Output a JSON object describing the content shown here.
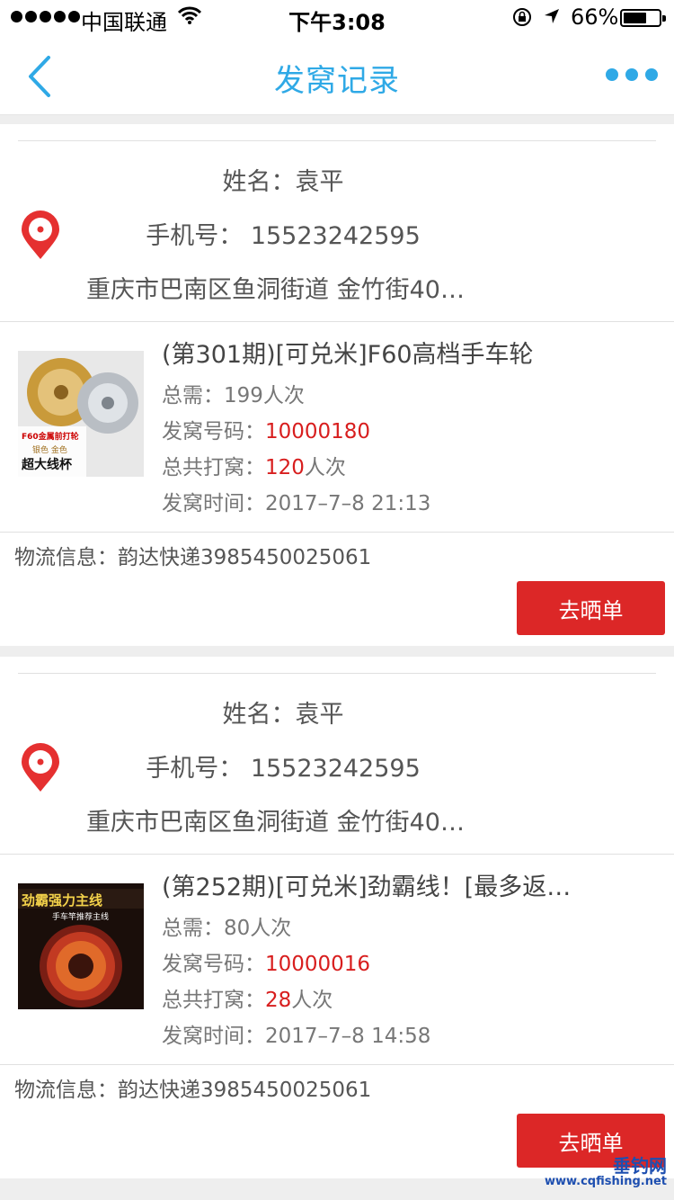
{
  "status_bar": {
    "carrier": "中国联通",
    "time": "下午3:08",
    "battery_percent": "66%",
    "battery_level": 0.66
  },
  "nav": {
    "title": "发窝记录"
  },
  "records": [
    {
      "name_label": "姓名：",
      "name": "袁平",
      "phone_label": "手机号：",
      "phone": "15523242595",
      "address": "重庆市巴南区鱼洞街道 金竹街40…",
      "product_title": "(第301期)[可兑米]F60高档手车轮",
      "thumb_lines": [
        "F60金属前打轮",
        "银色  金色",
        "超大线杯"
      ],
      "total_label": "总需：",
      "total_value": "199人次",
      "code_label": "发窝号码：",
      "code_value": "10000180",
      "played_label": "总共打窝：",
      "played_count": "120",
      "played_unit": "人次",
      "time_label": "发窝时间：",
      "time_value": "2017–7–8 21:13",
      "logistics": "物流信息：韵达快递3985450025061",
      "button": "去晒单"
    },
    {
      "name_label": "姓名：",
      "name": "袁平",
      "phone_label": "手机号：",
      "phone": "15523242595",
      "address": "重庆市巴南区鱼洞街道 金竹街40…",
      "product_title": "(第252期)[可兑米]劲霸线！[最多返…",
      "thumb_lines": [
        "劲霸强力主线",
        "手车竿推荐主线"
      ],
      "total_label": "总需：",
      "total_value": "80人次",
      "code_label": "发窝号码：",
      "code_value": "10000016",
      "played_label": "总共打窝：",
      "played_count": "28",
      "played_unit": "人次",
      "time_label": "发窝时间：",
      "time_value": "2017–7–8 14:58",
      "logistics": "物流信息：韵达快递3985450025061",
      "button": "去晒单"
    }
  ],
  "watermark": {
    "text": "垂钓网",
    "url": "www.cqfishing.net"
  },
  "colors": {
    "accent": "#2fa9e6",
    "button": "#dc2727",
    "highlight": "#d81e1e"
  }
}
